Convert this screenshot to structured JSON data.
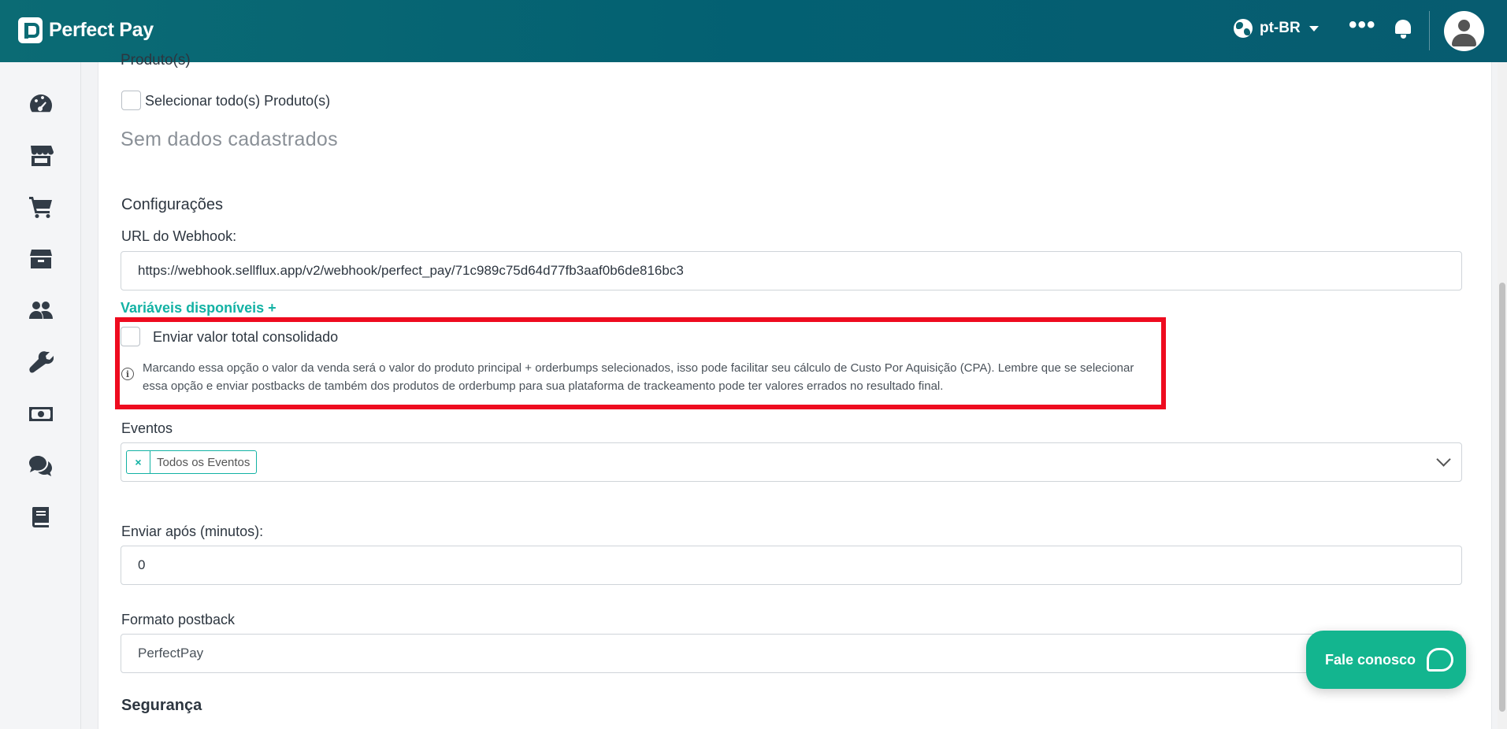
{
  "header": {
    "logo_text": "Perfect Pay",
    "language": "pt-BR",
    "more_icon": "ellipsis-icon",
    "notifications_icon": "bell-icon",
    "avatar_icon": "user-avatar-icon"
  },
  "sidebar": {
    "items": [
      {
        "icon": "dashboard-gauge-icon"
      },
      {
        "icon": "store-icon"
      },
      {
        "icon": "cart-icon"
      },
      {
        "icon": "box-icon"
      },
      {
        "icon": "users-icon"
      },
      {
        "icon": "wrench-icon"
      },
      {
        "icon": "money-icon"
      },
      {
        "icon": "chat-icon"
      },
      {
        "icon": "book-icon"
      }
    ]
  },
  "form": {
    "products_heading": "Produto(s)",
    "select_all_label": "Selecionar todo(s) Produto(s)",
    "empty_message": "Sem dados cadastrados",
    "settings_heading": "Configurações",
    "webhook_label": "URL do Webhook:",
    "webhook_value": "https://webhook.sellflux.app/v2/webhook/perfect_pay/71c989c75d64d77fb3aaf0b6de816bc3",
    "variables_link": "Variáveis disponíveis +",
    "consolidated_label": "Enviar valor total consolidado",
    "consolidated_info": "Marcando essa opção o valor da venda será o valor do produto principal + orderbumps selecionados, isso pode facilitar seu cálculo de Custo Por Aquisição (CPA). Lembre que se selecionar essa opção e enviar postbacks de também dos produtos de orderbump para sua plataforma de trackeamento pode ter valores errados no resultado final.",
    "events_label": "Eventos",
    "events_tag": "Todos os Eventos",
    "events_tag_remove": "×",
    "delay_label": "Enviar após (minutos):",
    "delay_value": "0",
    "postback_format_label": "Formato postback",
    "postback_format_value": "PerfectPay",
    "security_heading": "Segurança"
  },
  "chat_widget": {
    "label": "Fale conosco"
  },
  "colors": {
    "header_bg": "#075c70",
    "accent": "#13b2a4",
    "chat_bg": "#13b58f",
    "highlight_border": "#ee0b1f"
  }
}
